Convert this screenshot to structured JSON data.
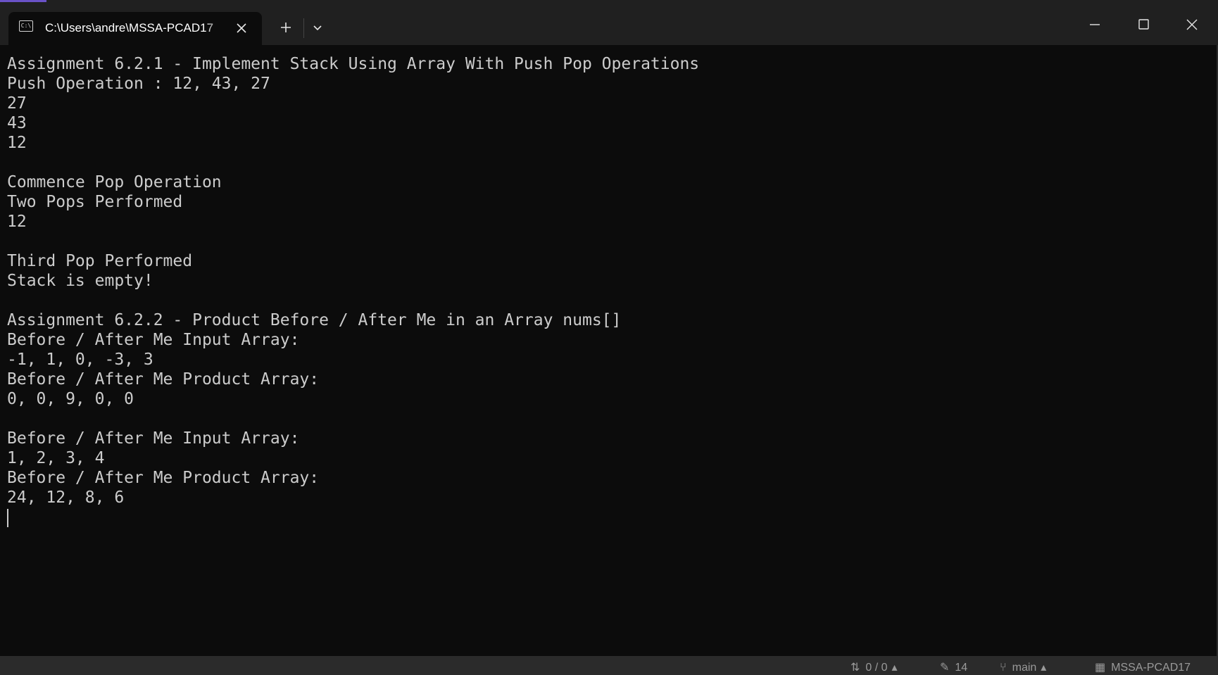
{
  "window": {
    "tab_title": "C:\\Users\\andre\\MSSA-PCAD17",
    "tab_icon_label": "C:\\"
  },
  "terminal": {
    "lines": [
      "Assignment 6.2.1 - Implement Stack Using Array With Push Pop Operations",
      "Push Operation : 12, 43, 27",
      "27",
      "43",
      "12",
      "",
      "Commence Pop Operation",
      "Two Pops Performed",
      "12",
      "",
      "Third Pop Performed",
      "Stack is empty!",
      "",
      "Assignment 6.2.2 - Product Before / After Me in an Array nums[]",
      "Before / After Me Input Array:",
      "-1, 1, 0, -3, 3",
      "Before / After Me Product Array:",
      "0, 0, 9, 0, 0",
      "",
      "Before / After Me Input Array:",
      "1, 2, 3, 4",
      "Before / After Me Product Array:",
      "24, 12, 8, 6"
    ]
  },
  "statusbar": {
    "sync": "0 / 0",
    "edits": "14",
    "branch": "main",
    "repo": "MSSA-PCAD17"
  },
  "colors": {
    "terminal_bg": "#0c0c0c",
    "titlebar_bg": "#202020",
    "text": "#cccccc",
    "accent": "#6a52c7"
  }
}
